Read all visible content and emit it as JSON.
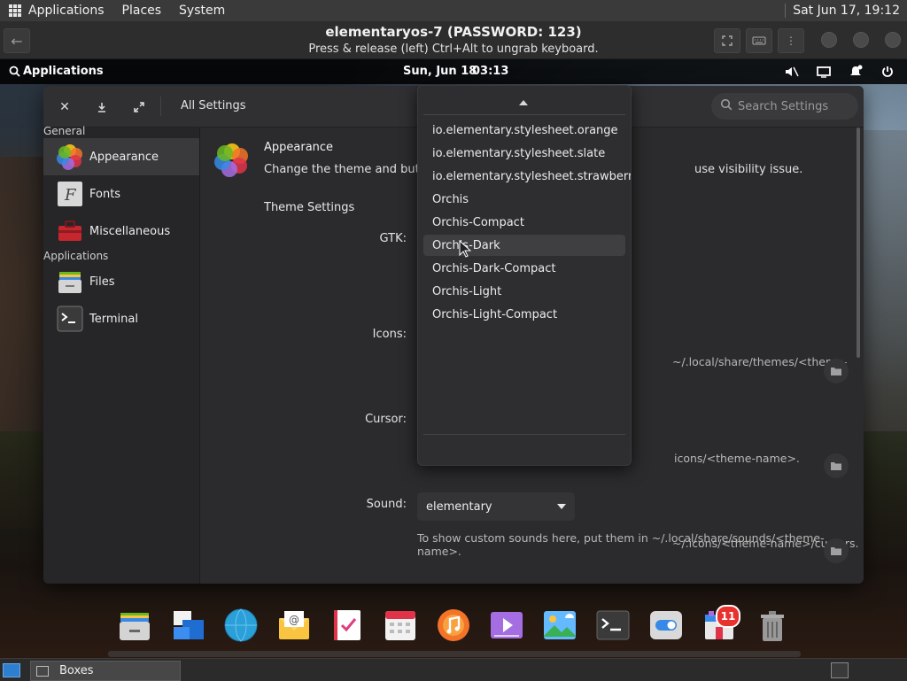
{
  "host_panel": {
    "menus": [
      "Applications",
      "Places",
      "System"
    ],
    "clock": "Sat Jun 17, 19:12"
  },
  "vm_header": {
    "title": "elementaryos-7 (PASSWORD: 123)",
    "subtitle": "Press & release (left) Ctrl+Alt to ungrab keyboard."
  },
  "wingpanel": {
    "apps_label": "Applications",
    "date": "Sun, Jun 18",
    "time": "03:13",
    "indicators": [
      "sound-muted-icon",
      "display-icon",
      "notifications-icon",
      "power-icon"
    ]
  },
  "settings": {
    "all_settings_label": "All Settings",
    "search_placeholder": "Search Settings",
    "sidebar": {
      "categories": [
        "General",
        "Applications"
      ],
      "general_items": [
        {
          "label": "Appearance",
          "icon": "appearance-icon",
          "active": true
        },
        {
          "label": "Fonts",
          "icon": "fonts-icon"
        },
        {
          "label": "Miscellaneous",
          "icon": "toolbox-icon"
        }
      ],
      "application_items": [
        {
          "label": "Files",
          "icon": "files-icon"
        },
        {
          "label": "Terminal",
          "icon": "terminal-icon"
        }
      ]
    },
    "content": {
      "title": "Appearance",
      "description_left": "Change the theme and button l",
      "description_right": "use visibility issue.",
      "section": "Theme Settings",
      "gtk_label": "GTK:",
      "gtk_hint": "~/.local/share/themes/<theme-",
      "icons_label": "Icons:",
      "icons_hint": "icons/<theme-name>.",
      "cursor_label": "Cursor:",
      "cursor_hint": "~/.icons/<theme-name>/cursors.",
      "sound_label": "Sound:",
      "sound_value": "elementary",
      "sound_hint_1": "To show custom sounds here, put them in ~/.local/share/sounds/<theme-",
      "sound_hint_2": "name>."
    },
    "popup_options": [
      "io.elementary.stylesheet.orange",
      "io.elementary.stylesheet.slate",
      "io.elementary.stylesheet.strawberry",
      "Orchis",
      "Orchis-Compact",
      "Orchis-Dark",
      "Orchis-Dark-Compact",
      "Orchis-Light",
      "Orchis-Light-Compact"
    ],
    "popup_hovered": "Orchis-Dark"
  },
  "dock": {
    "apps": [
      "files-app",
      "multitasking-view",
      "web-browser",
      "mail",
      "tasks",
      "calendar",
      "music",
      "videos",
      "photos",
      "terminal",
      "system-settings",
      "app-center",
      "trash"
    ],
    "app_center_badge": "11"
  },
  "host_taskbar": {
    "task_label": "Boxes"
  },
  "colors": {
    "accent": "#3f3f41",
    "badge": "#e8322e",
    "taskbar_blue": "#2f7fd1"
  }
}
